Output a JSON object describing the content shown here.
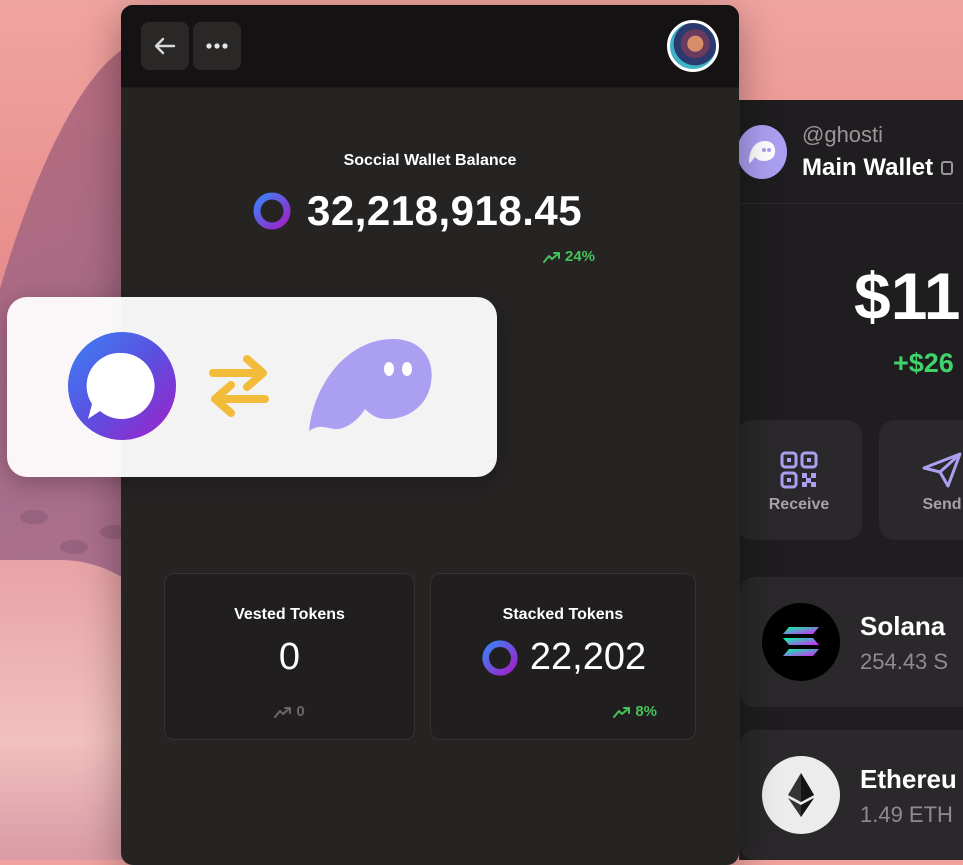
{
  "colors": {
    "panel_bg": "#262323",
    "header_bg": "#141212",
    "positive": "#45c25b",
    "wallet_positive": "#3fd36b",
    "phantom_purple": "#ab9ff2",
    "swap_yellow": "#f2bc3a",
    "muted": "#6b6666"
  },
  "header": {
    "back_icon": "arrow-left-icon",
    "more_icon": "more-horizontal-icon",
    "avatar_icon": "user-avatar"
  },
  "balance": {
    "label": "Soccial Wallet Balance",
    "value": "32,218,918.45",
    "change": "24%",
    "token_icon": "soccial-token-icon"
  },
  "tokens": {
    "vested": {
      "label": "Vested Tokens",
      "value": "0",
      "change": "0"
    },
    "stacked": {
      "label": "Stacked Tokens",
      "value": "22,202",
      "change": "8%"
    }
  },
  "bridge": {
    "left_icon": "soccial-logo-icon",
    "middle_icon": "swap-arrows-icon",
    "right_icon": "phantom-ghost-icon"
  },
  "wallet": {
    "handle": "@ghosti",
    "name": "Main Wallet",
    "usd_balance": "$11,",
    "usd_change": "+$26",
    "actions": [
      {
        "label": "Receive",
        "icon": "qr-code-icon"
      },
      {
        "label": "Send",
        "icon": "send-icon"
      }
    ],
    "assets": [
      {
        "name": "Solana",
        "amount": "254.43 S",
        "icon": "solana-icon"
      },
      {
        "name": "Ethereu",
        "amount": "1.49 ETH",
        "icon": "ethereum-icon"
      }
    ]
  }
}
